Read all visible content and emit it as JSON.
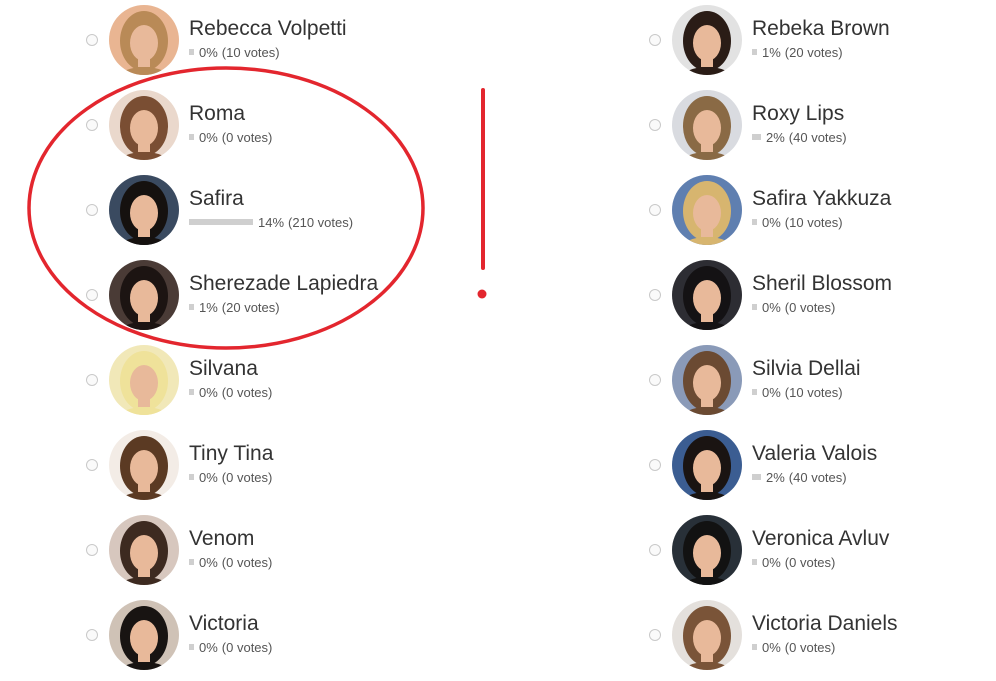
{
  "poll": {
    "left_column": [
      {
        "name": "Rebecca Volpetti",
        "percent": "0%",
        "votes": "(10 votes)",
        "share": 0,
        "avatar_bg": "#e9b592",
        "hair": "#b98a57"
      },
      {
        "name": "Roma",
        "percent": "0%",
        "votes": "(0 votes)",
        "share": 0,
        "avatar_bg": "#ead8cc",
        "hair": "#7a4e33"
      },
      {
        "name": "Safira",
        "percent": "14%",
        "votes": "(210 votes)",
        "share": 14,
        "avatar_bg": "#3a4a60",
        "hair": "#15110f"
      },
      {
        "name": "Sherezade Lapiedra",
        "percent": "1%",
        "votes": "(20 votes)",
        "share": 1,
        "avatar_bg": "#4a3b36",
        "hair": "#1c1412"
      },
      {
        "name": "Silvana",
        "percent": "0%",
        "votes": "(0 votes)",
        "share": 0,
        "avatar_bg": "#f1e8b8",
        "hair": "#efe29a"
      },
      {
        "name": "Tiny Tina",
        "percent": "0%",
        "votes": "(0 votes)",
        "share": 0,
        "avatar_bg": "#f3ece6",
        "hair": "#5b3a23"
      },
      {
        "name": "Venom",
        "percent": "0%",
        "votes": "(0 votes)",
        "share": 0,
        "avatar_bg": "#d7c7be",
        "hair": "#3d2a20"
      },
      {
        "name": "Victoria",
        "percent": "0%",
        "votes": "(0 votes)",
        "share": 0,
        "avatar_bg": "#cfc2b6",
        "hair": "#181412"
      }
    ],
    "right_column": [
      {
        "name": "Rebeka Brown",
        "percent": "1%",
        "votes": "(20 votes)",
        "share": 1,
        "avatar_bg": "#e2e2e2",
        "hair": "#2a1c16"
      },
      {
        "name": "Roxy Lips",
        "percent": "2%",
        "votes": "(40 votes)",
        "share": 2,
        "avatar_bg": "#d9dbe0",
        "hair": "#8a6a45"
      },
      {
        "name": "Safira Yakkuza",
        "percent": "0%",
        "votes": "(10 votes)",
        "share": 0,
        "avatar_bg": "#5f7fb0",
        "hair": "#d7b56f"
      },
      {
        "name": "Sheril Blossom",
        "percent": "0%",
        "votes": "(0 votes)",
        "share": 0,
        "avatar_bg": "#2d2d33",
        "hair": "#141214"
      },
      {
        "name": "Silvia Dellai",
        "percent": "0%",
        "votes": "(10 votes)",
        "share": 0,
        "avatar_bg": "#8a9ab8",
        "hair": "#6b4a32"
      },
      {
        "name": "Valeria Valois",
        "percent": "2%",
        "votes": "(40 votes)",
        "share": 2,
        "avatar_bg": "#3b5d92",
        "hair": "#1a1412"
      },
      {
        "name": "Veronica Avluv",
        "percent": "0%",
        "votes": "(0 votes)",
        "share": 0,
        "avatar_bg": "#283038",
        "hair": "#121212"
      },
      {
        "name": "Victoria Daniels",
        "percent": "0%",
        "votes": "(0 votes)",
        "share": 0,
        "avatar_bg": "#e4e0dc",
        "hair": "#7a5438"
      }
    ]
  },
  "colors": {
    "annotation_red": "#e3262e",
    "bar_gray": "#cfcfcf",
    "skin": "#e8b99a"
  }
}
